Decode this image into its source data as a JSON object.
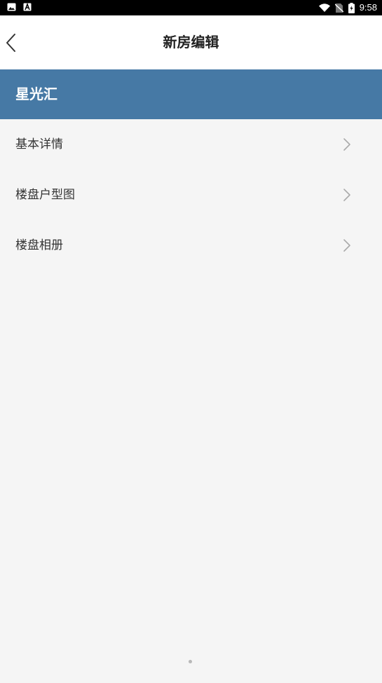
{
  "status_bar": {
    "time": "9:58",
    "icons": [
      "image-notification-icon",
      "font-notification-icon",
      "wifi-icon",
      "no-sim-icon",
      "battery-icon"
    ]
  },
  "nav": {
    "title": "新房编辑",
    "back_icon": "chevron-left-icon"
  },
  "banner": {
    "project_name": "星光汇",
    "color": "#4679a5"
  },
  "menu": {
    "items": [
      {
        "label": "基本详情",
        "icon": "chevron-right-icon"
      },
      {
        "label": "楼盘户型图",
        "icon": "chevron-right-icon"
      },
      {
        "label": "楼盘相册",
        "icon": "chevron-right-icon"
      }
    ]
  },
  "colors": {
    "background": "#f5f5f5",
    "nav_background": "#ffffff",
    "text_primary": "#222222",
    "text_menu": "#333333",
    "chevron": "#aaaaaa"
  }
}
